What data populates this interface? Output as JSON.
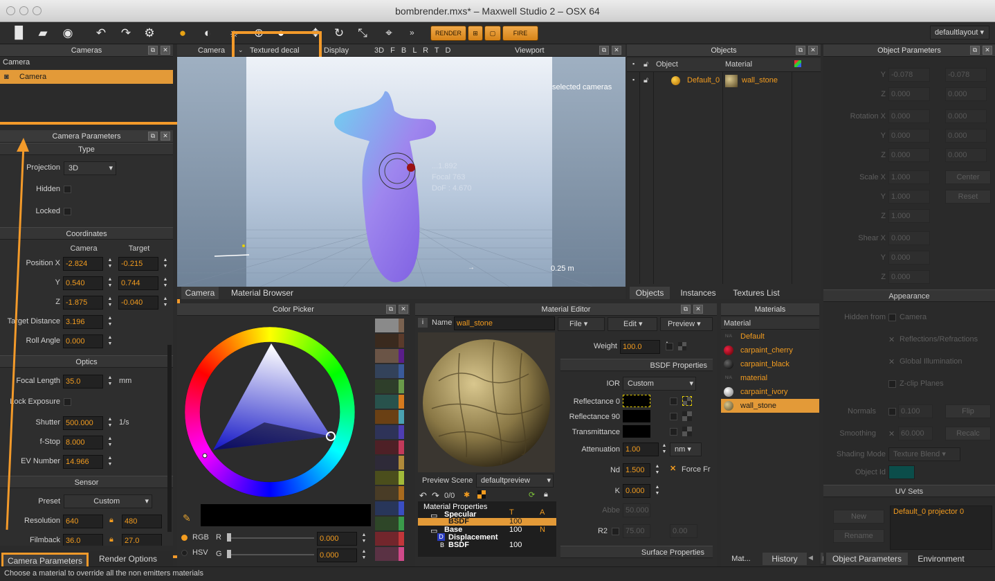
{
  "window": {
    "title": "bombrender.mxs* – Maxwell Studio 2 –  OSX 64"
  },
  "toolbar": {
    "render_label": "RENDER",
    "fire_label": "FIRE",
    "layout": "defaultlayout",
    "more": "»"
  },
  "cameras": {
    "title": "Cameras",
    "root": "Camera",
    "item": "Camera"
  },
  "camera_params": {
    "title": "Camera Parameters",
    "type_section": "Type",
    "projection_label": "Projection",
    "projection_value": "3D",
    "hidden_label": "Hidden",
    "locked_label": "Locked",
    "coords_section": "Coordinates",
    "col_camera": "Camera",
    "col_target": "Target",
    "pos_x_label": "Position X",
    "pos_x_cam": "-2.824",
    "pos_x_tgt": "-0.215",
    "y_label": "Y",
    "y_cam": "0.540",
    "y_tgt": "0.744",
    "z_label": "Z",
    "z_cam": "-1.875",
    "z_tgt": "-0.040",
    "target_dist_label": "Target Distance",
    "target_dist": "3.196",
    "roll_label": "Roll Angle",
    "roll": "0.000",
    "optics_section": "Optics",
    "focal_label": "Focal Length",
    "focal": "35.0",
    "focal_unit": "mm",
    "lock_exp_label": "Lock Exposure",
    "shutter_label": "Shutter",
    "shutter": "500.000",
    "shutter_unit": "1/s",
    "fstop_label": "f-Stop",
    "fstop": "8.000",
    "ev_label": "EV Number",
    "ev": "14.966",
    "sensor_section": "Sensor",
    "preset_label": "Preset",
    "preset": "Custom",
    "resolution_label": "Resolution",
    "res_w": "640",
    "res_h": "480",
    "filmback_label": "Filmback",
    "film_w": "36.0",
    "film_h": "27.0"
  },
  "left_tabs": {
    "camera_params": "Camera Parameters",
    "render_options": "Render Options"
  },
  "status": "Choose a material to override all the non emitters materials",
  "viewport": {
    "camera": "Camera",
    "shading": "Textured decal",
    "display": "Display",
    "views": [
      "3D",
      "F",
      "B",
      "L",
      "R",
      "T",
      "D"
    ],
    "title": "Viewport",
    "overlay": "selected cameras",
    "hud1": "...1.892",
    "hud2": "Focal 763",
    "hud3": "DoF : 4.670",
    "scale": "0.25 m"
  },
  "bottom_tabs": {
    "camera": "Camera",
    "browser": "Material Browser"
  },
  "color_picker": {
    "title": "Color Picker",
    "rgb": "RGB",
    "hsv": "HSV",
    "r_label": "R",
    "g_label": "G",
    "r_val": "0.000",
    "g_val": "0.000",
    "swatches": [
      "#8a8a8a",
      "#3a2a1e",
      "#6a5446",
      "#33425a",
      "#2e3e2a",
      "#28524c",
      "#6a4014",
      "#2e3358",
      "#4e2026",
      "#2e2a38",
      "#4b4e1c",
      "#493c26",
      "#28365a",
      "#2e4628",
      "#72262c",
      "#5a3244"
    ],
    "swatch_accents": [
      "#7a6250",
      "#5a3a2a",
      "#5a1e8a",
      "#3a5a9a",
      "#6a9a4a",
      "#d67a1e",
      "#4aa2b2",
      "#4e3eb2",
      "#c23a5a",
      "#b08a3a",
      "#a2ba3a",
      "#a86a1e",
      "#3a4ec2",
      "#3a9a4a",
      "#c2363a",
      "#d04a8a"
    ]
  },
  "material_editor": {
    "title": "Material Editor",
    "name_label": "Name",
    "name": "wall_stone",
    "menu": [
      "File",
      "Edit",
      "Preview"
    ],
    "weight_label": "Weight",
    "weight": "100.0",
    "bsdf_props": "BSDF Properties",
    "ior_label": "IOR",
    "ior": "Custom",
    "refl0_label": "Reflectance 0",
    "refl90_label": "Reflectance 90",
    "trans_label": "Transmittance",
    "atten_label": "Attenuation",
    "atten": "1.00",
    "atten_unit": "nm",
    "nd_label": "Nd",
    "nd": "1.500",
    "force_label": "Force Fr",
    "k_label": "K",
    "k": "0.000",
    "abbe_label": "Abbe",
    "abbe": "50.000",
    "r2_label": "R2",
    "r2a": "75.00",
    "r2b": "0.00",
    "surface_props": "Surface Properties",
    "preview_scene_label": "Preview Scene",
    "preview_scene": "defaultpreview",
    "layer_count": "0/0",
    "tree": [
      {
        "name": "Material Properties",
        "t": "T",
        "a": "A"
      },
      {
        "name": "Specular",
        "t": "",
        "a": ""
      },
      {
        "name": "BSDF",
        "t": "100",
        "a": "N"
      },
      {
        "name": "Base",
        "t": "100",
        "a": "N"
      },
      {
        "name": "Displacement",
        "t": "",
        "a": ""
      },
      {
        "name": "BSDF",
        "t": "100",
        "a": ""
      }
    ]
  },
  "materials": {
    "title": "Materials",
    "header": "Material",
    "items": [
      {
        "tag": "N/A",
        "name": "Default"
      },
      {
        "tag": "",
        "name": "carpaint_cherry"
      },
      {
        "tag": "",
        "name": "carpaint_black"
      },
      {
        "tag": "N/A",
        "name": "material"
      },
      {
        "tag": "",
        "name": "carpaint_ivory"
      },
      {
        "tag": "",
        "name": "wall_stone"
      }
    ],
    "tab_mat": "Mat...",
    "tab_history": "History"
  },
  "objects": {
    "title": "Objects",
    "col_object": "Object",
    "col_material": "Material",
    "row_object": "Default_0",
    "row_material": "wall_stone",
    "tabs": [
      "Objects",
      "Instances",
      "Textures List"
    ]
  },
  "object_params": {
    "title": "Object Parameters",
    "y_label": "Y",
    "y1": "-0.078",
    "y2": "-0.078",
    "z_label": "Z",
    "z1": "0.000",
    "z2": "0.000",
    "rot_x_label": "Rotation X",
    "rot": "0.000",
    "scale_x_label": "Scale X",
    "scale": "1.000",
    "center": "Center",
    "reset": "Reset",
    "shear_x_label": "Shear X",
    "shear": "0.000",
    "appearance": "Appearance",
    "hidden_from": "Hidden from",
    "cam_opt": "Camera",
    "refl_opt": "Reflections/Refractions",
    "gi_opt": "Global Illumination",
    "zclip_opt": "Z-clip Planes",
    "normals_label": "Normals",
    "normals": "0.100",
    "flip": "Flip",
    "smoothing_label": "Smoothing",
    "smoothing": "60.000",
    "recalc": "Recalc",
    "shading_label": "Shading Mode",
    "shading": "Texture Blend",
    "objid_label": "Object Id",
    "uv_sets": "UV Sets",
    "new_btn": "New",
    "rename_btn": "Rename",
    "uv_item": "Default_0 projector 0",
    "tabs": [
      "Object Parameters",
      "Environment"
    ]
  },
  "colors": {
    "accent": "#f39c1f",
    "highlight": "#f39a2a"
  }
}
